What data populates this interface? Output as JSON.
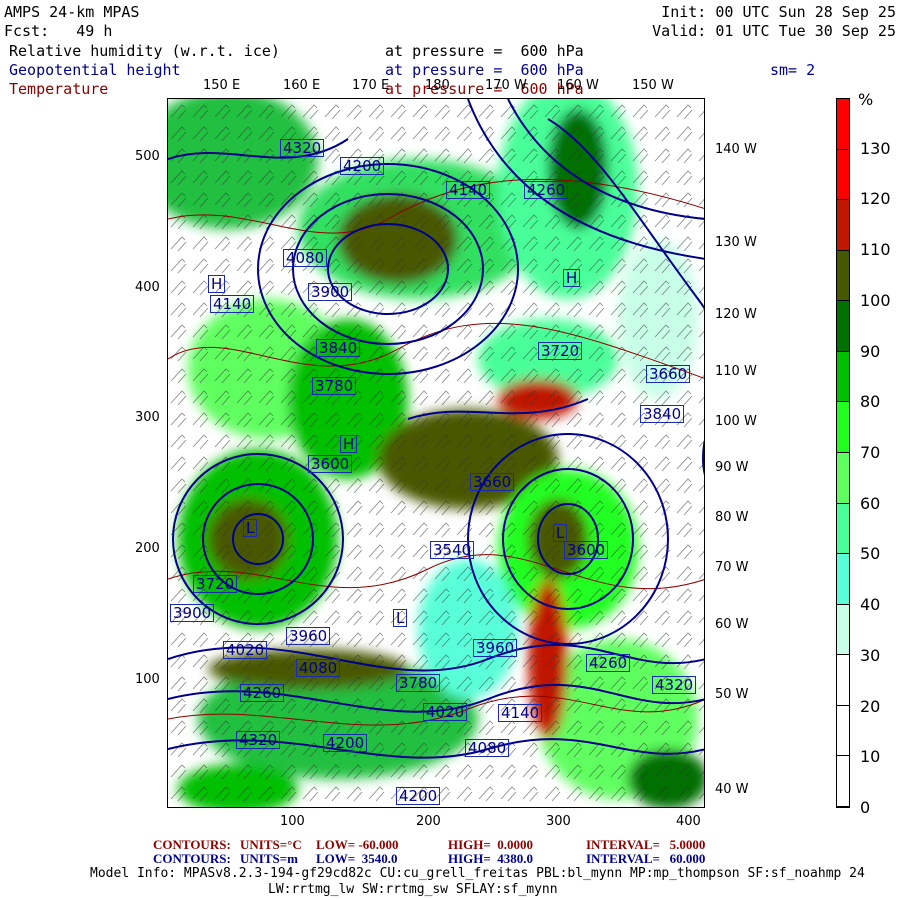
{
  "header": {
    "title": "AMPS 24-km MPAS",
    "fcst": "Fcst:   49 h",
    "init": "Init: 00 UTC Sun 28 Sep 25",
    "valid": "Valid: 01 UTC Tue 30 Sep 25",
    "fields": [
      {
        "name": "Relative humidity (w.r.t. ice)",
        "level": "at pressure =  600 hPa",
        "color": "#000000"
      },
      {
        "name": "Geopotential height",
        "level": "at pressure =  600 hPa",
        "color": "#00008c"
      },
      {
        "name": "Temperature",
        "level": "at pressure =  600 hPa",
        "color": "#8c0000"
      }
    ],
    "smoothing": "sm= 2"
  },
  "axes": {
    "top_lon": [
      "150 E",
      "160 E",
      "170 E",
      "180",
      "170 W",
      "160 W",
      "150 W"
    ],
    "right_lon": [
      "140 W",
      "130 W",
      "120 W",
      "110 W",
      "100 W",
      "90 W",
      "80 W",
      "70 W",
      "60 W",
      "50 W",
      "40 W"
    ],
    "left_y": [
      "500",
      "400",
      "300",
      "200",
      "100"
    ],
    "bottom_x": [
      "100",
      "200",
      "300",
      "400"
    ]
  },
  "colorbar": {
    "unit": "%",
    "labels": [
      "130",
      "120",
      "110",
      "100",
      "90",
      "80",
      "70",
      "60",
      "50",
      "40",
      "30",
      "20",
      "10",
      "0"
    ],
    "colors": [
      "#ff0000",
      "#ff0000",
      "#c01800",
      "#485800",
      "#007000",
      "#00c000",
      "#20ff20",
      "#60ff60",
      "#48ff98",
      "#58ffd8",
      "#c8ffe8",
      "#ffffff",
      "#ffffff",
      "#ffffff"
    ]
  },
  "contour_labels": [
    "4320",
    "4200",
    "4140",
    "4260",
    "4140",
    "4080",
    "3900",
    "3840",
    "3780",
    "3720",
    "3600",
    "3660",
    "3540",
    "3720",
    "3900",
    "3960",
    "4020",
    "4080",
    "4260",
    "4200",
    "4320",
    "4080",
    "4140",
    "3960",
    "3780",
    "4020",
    "4260",
    "4320",
    "4200",
    "3840",
    "3600",
    "3660"
  ],
  "highs_lows": [
    "H",
    "L",
    "H",
    "L",
    "H",
    "L"
  ],
  "footer": {
    "temp": {
      "contours": "CONTOURS:",
      "units": "UNITS=°C",
      "low": "LOW= -60.000",
      "high": "HIGH=  0.0000",
      "interval": "INTERVAL=   5.0000"
    },
    "height": {
      "contours": "CONTOURS:",
      "units": "UNITS=m",
      "low": "LOW=  3540.0",
      "high": "HIGH=  4380.0",
      "interval": "INTERVAL=   60.000"
    },
    "model_info_1": "Model Info: MPASv8.2.3-194-gf29cd82c CU:cu_grell_freitas PBL:bl_mynn MP:mp_thompson SF:sf_noahmp 24",
    "model_info_2": "LW:rrtmg_lw SW:rrtmg_sw SFLAY:sf_mynn"
  }
}
